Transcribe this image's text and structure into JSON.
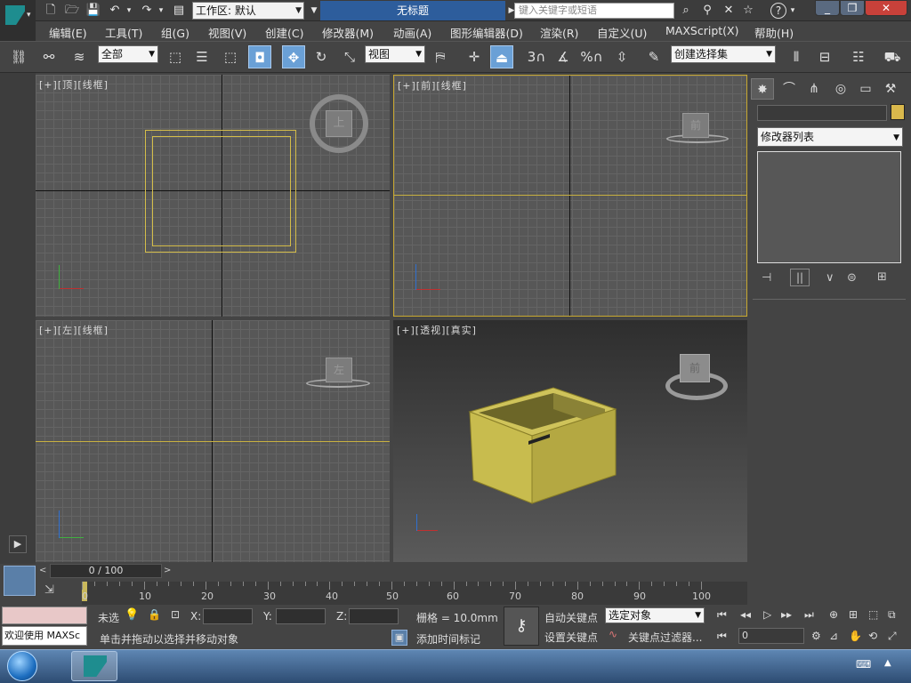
{
  "title_bar": {
    "workspace_label": "工作区: 默认",
    "document_title": "无标题",
    "search_placeholder": "键入关键字或短语"
  },
  "menu": [
    "编辑(E)",
    "工具(T)",
    "组(G)",
    "视图(V)",
    "创建(C)",
    "修改器(M)",
    "动画(A)",
    "图形编辑器(D)",
    "渲染(R)",
    "自定义(U)",
    "MAXScript(X)",
    "帮助(H)"
  ],
  "toolbar": {
    "selection_filter": "全部",
    "ref_coord": "视图",
    "named_selection": "创建选择集",
    "snap_labels": [
      "3",
      "%"
    ]
  },
  "viewports": {
    "top": {
      "label": "[+][顶][线框]",
      "viewcube": "上"
    },
    "front": {
      "label": "[+][前][线框]",
      "viewcube": "前"
    },
    "left": {
      "label": "[+][左][线框]",
      "viewcube": "左"
    },
    "perspective": {
      "label": "[+][透视][真实]",
      "viewcube": "前"
    }
  },
  "command_panel": {
    "modifier_list": "修改器列表"
  },
  "timeline": {
    "position": "0 / 100",
    "ticks": [
      "0",
      "10",
      "20",
      "30",
      "40",
      "50",
      "60",
      "70",
      "80",
      "90",
      "100"
    ]
  },
  "status": {
    "maxscript_welcome": "欢迎使用 MAXSc",
    "selection_state": "未选",
    "x_label": "X:",
    "y_label": "Y:",
    "z_label": "Z:",
    "grid": "栅格 = 10.0mm",
    "prompt": "单击并拖动以选择并移动对象",
    "add_time_tag": "添加时间标记",
    "auto_key": "自动关键点",
    "set_key": "设置关键点",
    "key_mode": "选定对象",
    "key_filter": "关键点过滤器...",
    "frame": "0"
  },
  "colors": {
    "accent": "#6aa0d6",
    "object": "#c9bd4f",
    "selection_outline": "#c8b040"
  }
}
